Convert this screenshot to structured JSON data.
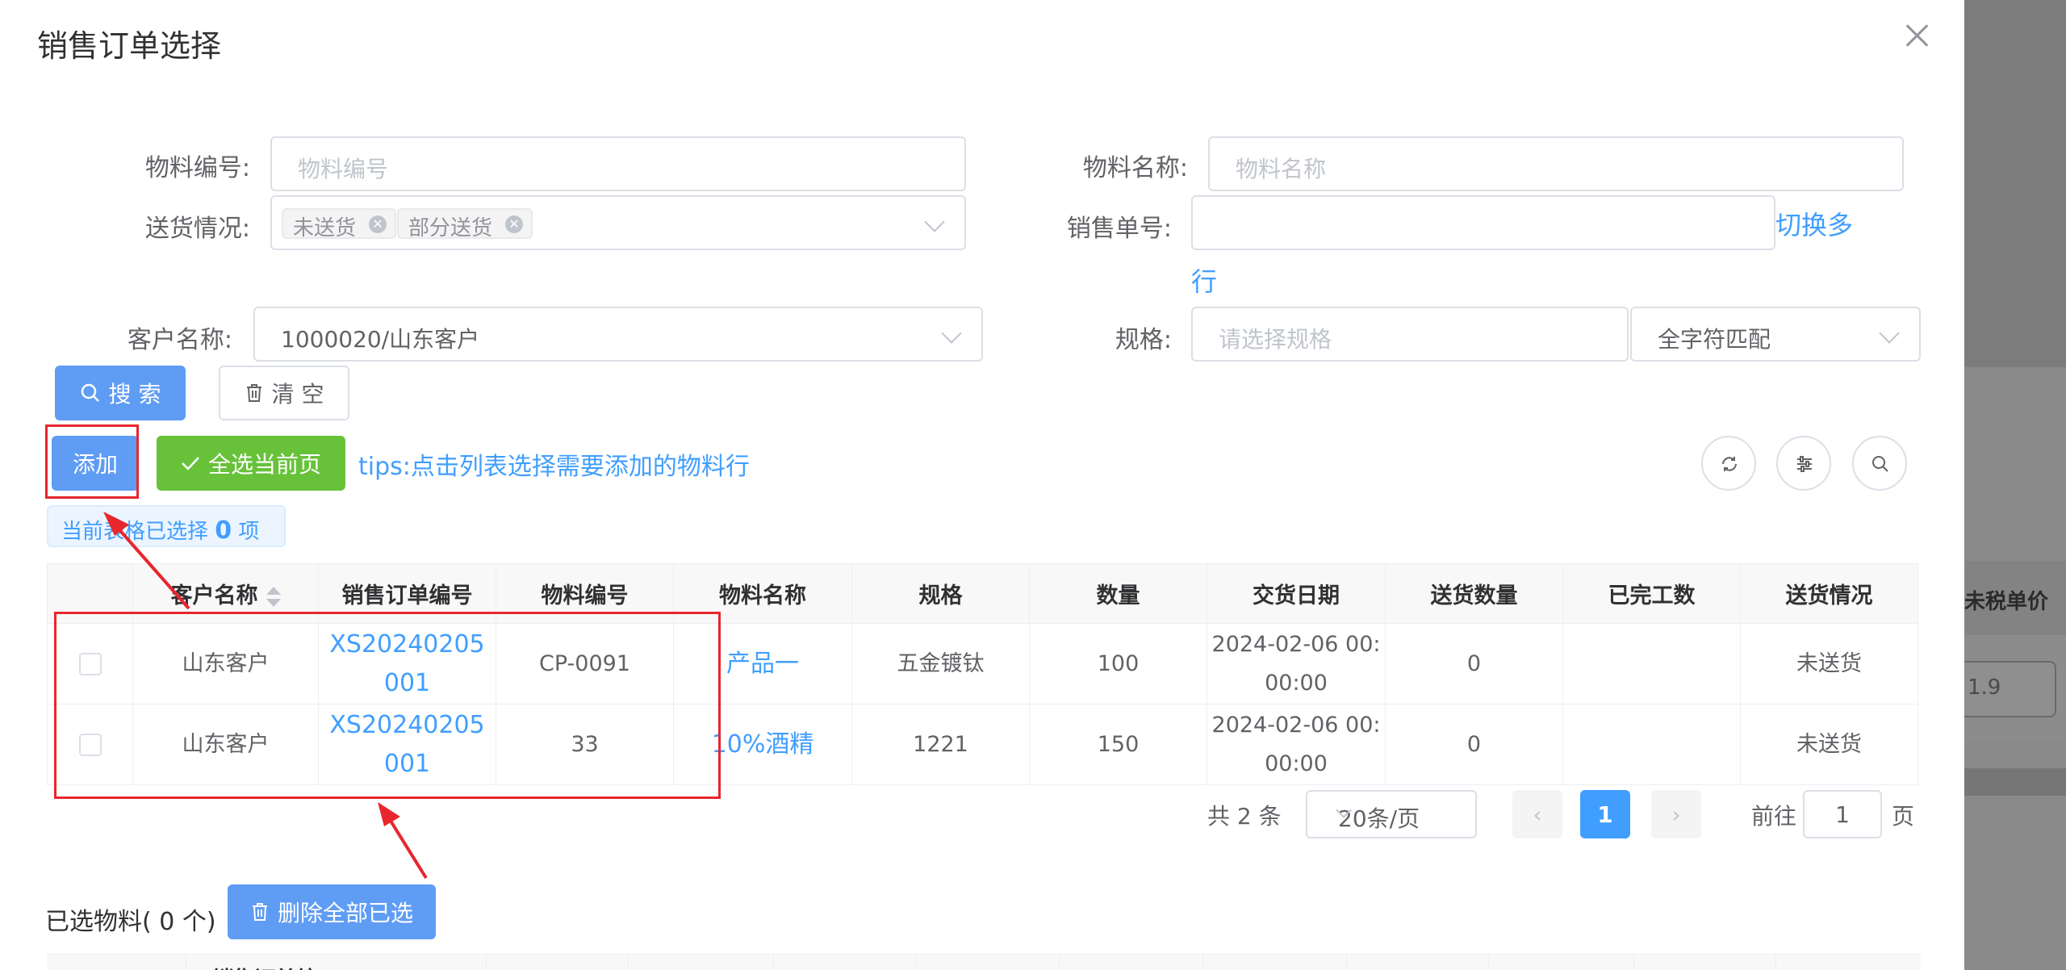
{
  "dialog": {
    "title": "销售订单选择"
  },
  "filters": {
    "material_code": {
      "label": "物料编号:",
      "placeholder": "物料编号"
    },
    "material_name": {
      "label": "物料名称:",
      "placeholder": "物料名称"
    },
    "delivery_status": {
      "label": "送货情况:",
      "tags": [
        "未送货",
        "部分送货"
      ]
    },
    "sales_order_no": {
      "label": "销售单号:",
      "value": "",
      "switch_link_line1": "切换多",
      "switch_link_line2": "行"
    },
    "customer_name": {
      "label": "客户名称:",
      "value": "1000020/山东客户"
    },
    "spec": {
      "label": "规格:",
      "placeholder": "请选择规格",
      "match_mode": "全字符匹配"
    }
  },
  "buttons": {
    "search": "搜 索",
    "clear": "清 空",
    "add": "添加",
    "select_all_page": "全选当前页",
    "delete_all_selected": "删除全部已选"
  },
  "tips": "tips:点击列表选择需要添加的物料行",
  "selection_info": {
    "prefix": "当前表格已选择",
    "count": "0",
    "suffix": "项"
  },
  "table": {
    "columns": [
      "客户名称",
      "销售订单编号",
      "物料编号",
      "物料名称",
      "规格",
      "数量",
      "交货日期",
      "送货数量",
      "已完工数",
      "送货情况"
    ],
    "rows": [
      {
        "customer": "山东客户",
        "order_no_1": "XS20240205",
        "order_no_2": "001",
        "material_code": "CP-0091",
        "material_name": "产品一",
        "spec": "五金镀钛",
        "qty": "100",
        "date_1": "2024-02-06 00:",
        "date_2": "00:00",
        "delivered_qty": "0",
        "finished_qty": "",
        "status": "未送货"
      },
      {
        "customer": "山东客户",
        "order_no_1": "XS20240205",
        "order_no_2": "001",
        "material_code": "33",
        "material_name": "10%酒精",
        "spec": "1221",
        "qty": "150",
        "date_1": "2024-02-06 00:",
        "date_2": "00:00",
        "delivered_qty": "0",
        "finished_qty": "",
        "status": "未送货"
      }
    ]
  },
  "pagination": {
    "total": "共 2 条",
    "page_size": "20条/页",
    "current_page": "1",
    "goto_label": "前往",
    "goto_value": "1",
    "page_suffix": "页"
  },
  "selected_section": {
    "title": "已选物料( 0 个)",
    "first_column_partial": "销售订单编"
  },
  "background": {
    "column_header": "未税单价",
    "cell_value": "1.9"
  },
  "colors": {
    "primary": "#409eff",
    "success": "#67c23a",
    "annotation": "#e8262d"
  }
}
